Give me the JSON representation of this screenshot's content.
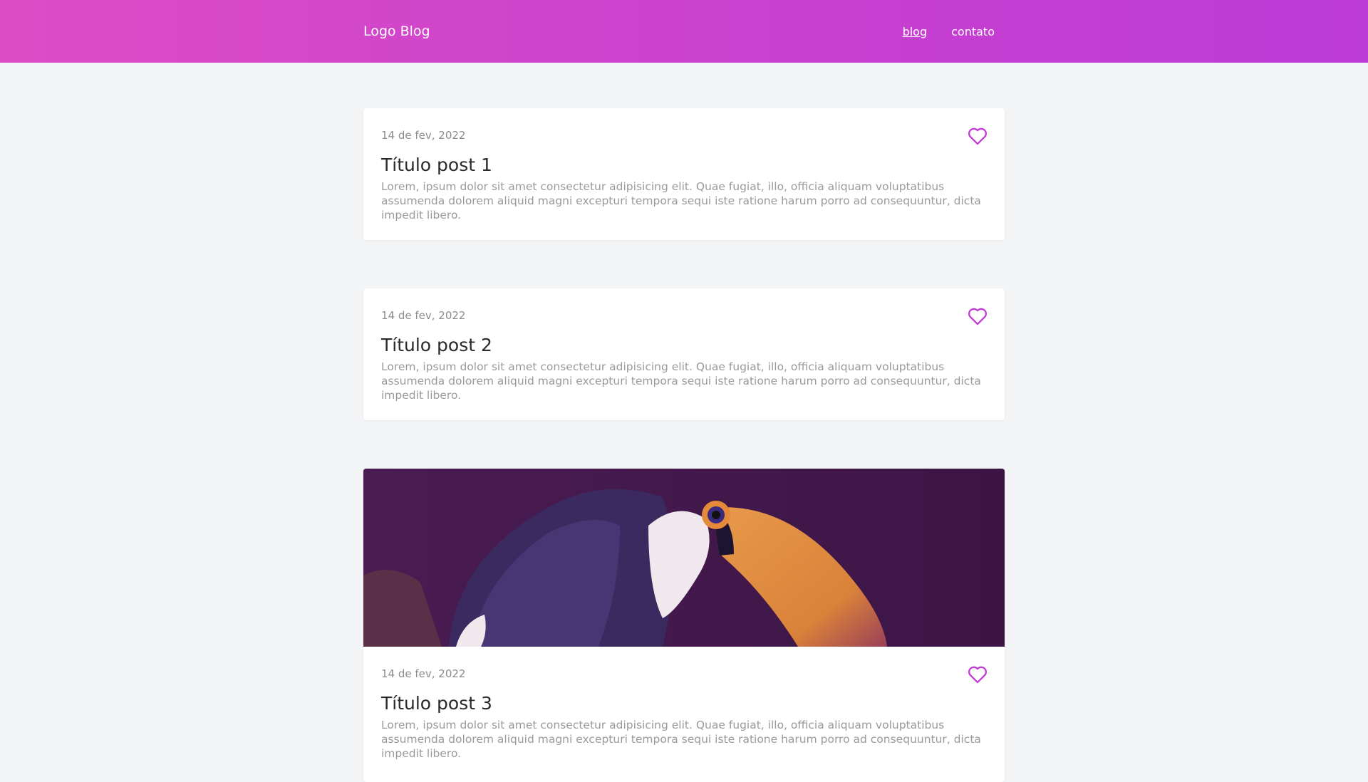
{
  "header": {
    "logo": "Logo Blog",
    "nav": [
      {
        "label": "blog",
        "active": true
      },
      {
        "label": "contato",
        "active": false
      }
    ]
  },
  "posts": [
    {
      "date": "14 de fev, 2022",
      "title": "Título post 1",
      "excerpt": "Lorem, ipsum dolor sit amet consectetur adipisicing elit. Quae fugiat, illo, officia aliquam voluptatibus assumenda dolorem aliquid magni excepturi tempora sequi iste ratione harum porro ad consequuntur, dicta impedit libero.",
      "has_image": false
    },
    {
      "date": "14 de fev, 2022",
      "title": "Título post 2",
      "excerpt": "Lorem, ipsum dolor sit amet consectetur adipisicing elit. Quae fugiat, illo, officia aliquam voluptatibus assumenda dolorem aliquid magni excepturi tempora sequi iste ratione harum porro ad consequuntur, dicta impedit libero.",
      "has_image": false
    },
    {
      "date": "14 de fev, 2022",
      "title": "Título post 3",
      "excerpt": "Lorem, ipsum dolor sit amet consectetur adipisicing elit. Quae fugiat, illo, officia aliquam voluptatibus assumenda dolorem aliquid magni excepturi tempora sequi iste ratione harum porro ad consequuntur, dicta impedit libero.",
      "has_image": true
    }
  ],
  "icons": {
    "like": "heart-outline-icon"
  },
  "colors": {
    "header_gradient_start": "#dc4cc5",
    "header_gradient_end": "#bb3bd8",
    "accent": "#c23fd3",
    "page_background": "#f3f4f6",
    "cover_tint": "#3f1747"
  }
}
